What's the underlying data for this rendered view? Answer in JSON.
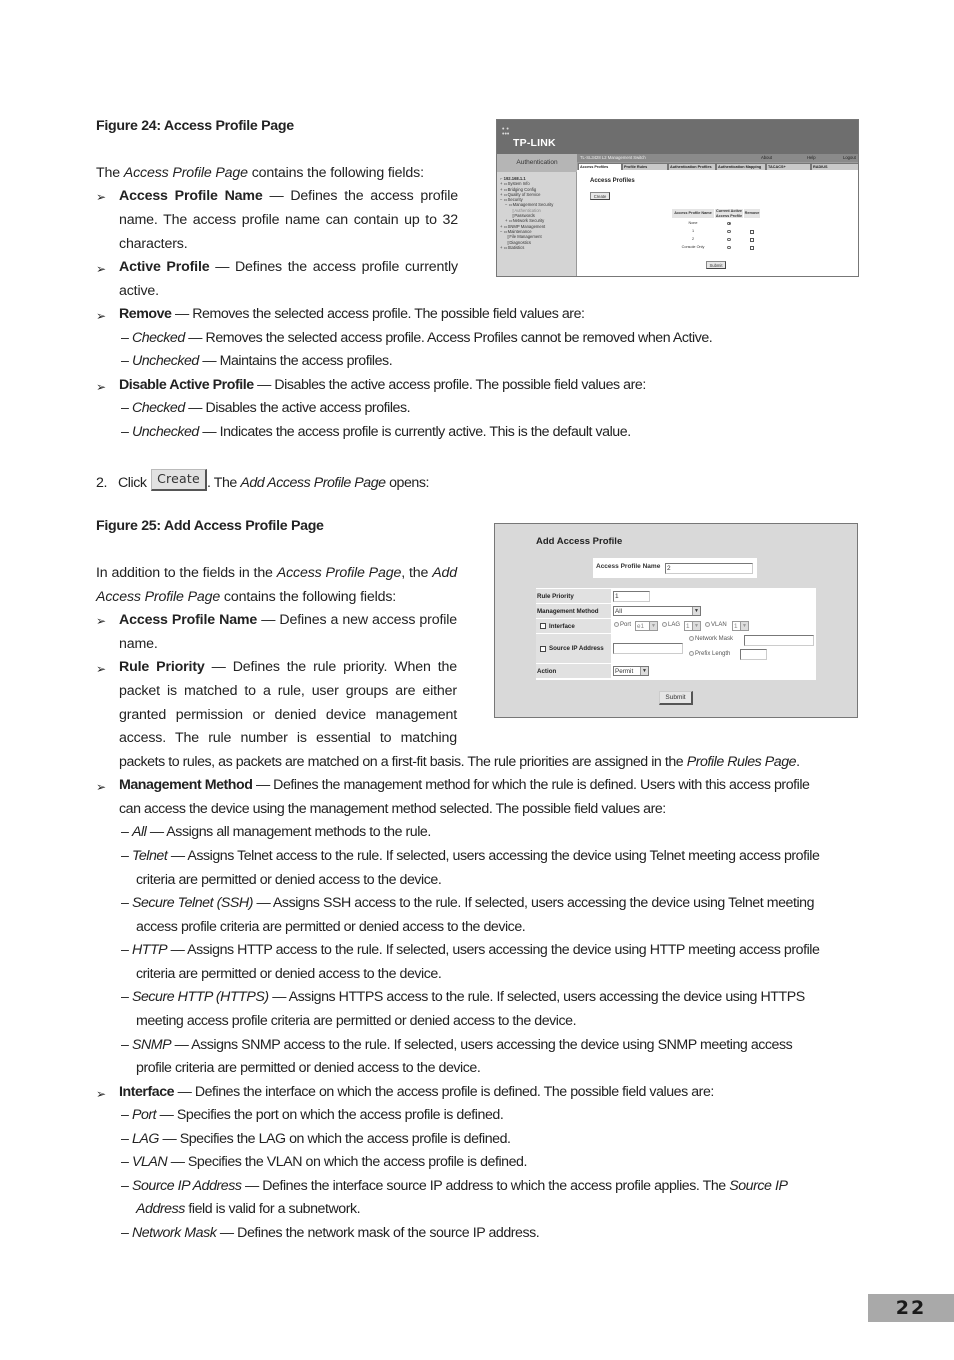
{
  "figure24": {
    "caption": "Figure 24: Access Profile Page",
    "screenshot": {
      "brand": "TP-LINK",
      "sidebar_header": "Authentication",
      "device_title": "TL-SL3428 L2 Management Switch",
      "top_links": [
        "About",
        "Help",
        "Logout"
      ],
      "tabs": [
        "Access Profiles",
        "Profile Rules",
        "Authentication Profiles",
        "Authentication Mapping",
        "TACACS+",
        "RADIUS"
      ],
      "active_tab": "Access Profiles",
      "tree": [
        "192.168.1.1",
        "System Info",
        "Bridging Config",
        "Quality of Service",
        "Security",
        "Management Security",
        "Authentication",
        "Passwords",
        "Network Security",
        "SNMP Management",
        "Maintenance",
        "File Management",
        "Diagnostics",
        "Statistics"
      ],
      "heading": "Access Profiles",
      "create_label": "Create",
      "table": {
        "headers": [
          "Access Profile Name",
          "Current Active Access Profile",
          "Remove"
        ],
        "rows": [
          {
            "name": "None",
            "active": true,
            "removable": false
          },
          {
            "name": "1",
            "active": false,
            "removable": true
          },
          {
            "name": "2",
            "active": false,
            "removable": true
          },
          {
            "name": "Console Only",
            "active": false,
            "removable": true
          }
        ]
      },
      "submit_label": "Submit"
    }
  },
  "intro24": {
    "pre": "The ",
    "em": "Access Profile Page",
    "post": " contains the following fields:"
  },
  "fields24": {
    "access_profile_name": {
      "term": "Access Profile Name",
      "line1": " — Defines the access profile",
      "line2": "name. The access profile name can contain up to 32",
      "line3": "characters."
    },
    "active_profile": {
      "term": "Active Profile",
      "line1": " — Defines the access profile currently",
      "line2": "active."
    },
    "remove": {
      "term": "Remove",
      "desc": " — Removes the selected access profile. The possible field values are:",
      "values": [
        {
          "name": "Checked",
          "desc": " — Removes the selected access profile. Access Profiles cannot be removed when Active."
        },
        {
          "name": "Unchecked",
          "desc": " — Maintains the access profiles."
        }
      ]
    },
    "disable_active_profile": {
      "term": "Disable Active Profile",
      "desc": " — Disables the active access profile. The possible field values are:",
      "values": [
        {
          "name": "Checked",
          "desc": " — Disables the active access profiles."
        },
        {
          "name": "Unchecked",
          "desc": " — Indicates the access profile is currently active. This is the default value."
        }
      ]
    }
  },
  "step2": {
    "number": "2.",
    "click": "Click",
    "button": "Create",
    "pre": ". The ",
    "em": "Add Access Profile Page",
    "post": " opens:"
  },
  "figure25": {
    "caption": "Figure 25: Add Access Profile Page",
    "screenshot": {
      "title": "Add Access Profile",
      "access_profile_name_label": "Access Profile Name",
      "access_profile_name_value": "2",
      "rule_priority_label": "Rule Priority",
      "rule_priority_value": "1",
      "management_method_label": "Management Method",
      "management_method_value": "All",
      "interface_label": "Interface",
      "interface_checked": false,
      "port_label": "Port",
      "port_value": "e1",
      "lag_label": "LAG",
      "lag_value": "1",
      "vlan_label": "VLAN",
      "vlan_value": "1",
      "source_ip_label": "Source IP Address",
      "source_ip_checked": false,
      "source_ip_value": "",
      "network_mask_label": "Network Mask",
      "network_mask_value": "",
      "prefix_length_label": "Prefix Length",
      "prefix_length_value": "",
      "action_label": "Action",
      "action_value": "Permit",
      "submit_label": "Submit"
    }
  },
  "intro25": {
    "pre": "In addition to the fields in the ",
    "em1": "Access Profile Page",
    "mid": ", the ",
    "em2a": "Add",
    "em2b": "Access Profile Page",
    "post": " contains the following fields:"
  },
  "fields25": {
    "access_profile_name": {
      "term": "Access Profile Name",
      "line1": " — Defines a new access profile",
      "line2": "name."
    },
    "rule_priority": {
      "term": "Rule Priority",
      "line1": " — Defines the rule priority. When the",
      "line2": "packet is matched to a rule, user groups are either",
      "line3": "granted permission or denied device management",
      "line4": "access. The rule number is essential to matching",
      "line5_pre": "packets to rules, as packets are matched on a first-fit basis. The rule priorities are assigned in the ",
      "line5_em": "Profile Rules Page",
      "line5_post": "."
    },
    "management_method": {
      "term": "Management Method",
      "line1": " — Defines the management method for which the rule is defined. Users with this access profile",
      "line2": "can access the device using the management method selected. The possible field values are:",
      "values": [
        {
          "name": "All",
          "line1": " — Assigns all management methods to the rule."
        },
        {
          "name": "Telnet",
          "line1": " — Assigns Telnet access to the rule. If selected, users accessing the device using Telnet meeting access profile",
          "line2": "criteria are permitted or denied access to the device."
        },
        {
          "name": "Secure Telnet (SSH)",
          "line1": " — Assigns SSH access to the rule. If selected, users accessing the device using Telnet meeting",
          "line2": "access profile criteria are permitted or denied access to the device."
        },
        {
          "name": "HTTP",
          "line1": " — Assigns HTTP access to the rule. If selected, users accessing the device using HTTP meeting access profile",
          "line2": "criteria are permitted or denied access to the device."
        },
        {
          "name": "Secure HTTP (HTTPS)",
          "line1": " — Assigns HTTPS access to the rule. If selected, users accessing the device using HTTPS",
          "line2": "meeting access profile criteria are permitted or denied access to the device."
        },
        {
          "name": "SNMP",
          "line1": " — Assigns SNMP access to the rule. If selected, users accessing the device using SNMP meeting access",
          "line2": "profile criteria are permitted or denied access to the device."
        }
      ]
    },
    "interface": {
      "term": "Interface",
      "desc": " — Defines the interface on which the access profile is defined. The possible field values are:",
      "values": [
        {
          "name": "Port",
          "line1": " — Specifies the port on which the access profile is defined."
        },
        {
          "name": "LAG",
          "line1": " — Specifies the LAG on which the access profile is defined."
        },
        {
          "name": "VLAN",
          "line1": " — Specifies the VLAN on which the access profile is defined."
        },
        {
          "name": "Source IP Address",
          "line1": " — Defines the interface source IP address to which the access profile applies. The ",
          "line1_em": "Source IP",
          "line2_em": "Address",
          "line2": " field is valid for a subnetwork."
        },
        {
          "name": "Network Mask",
          "line1": " — Defines the network mask of the source IP address."
        }
      ]
    }
  },
  "page_number": "22"
}
